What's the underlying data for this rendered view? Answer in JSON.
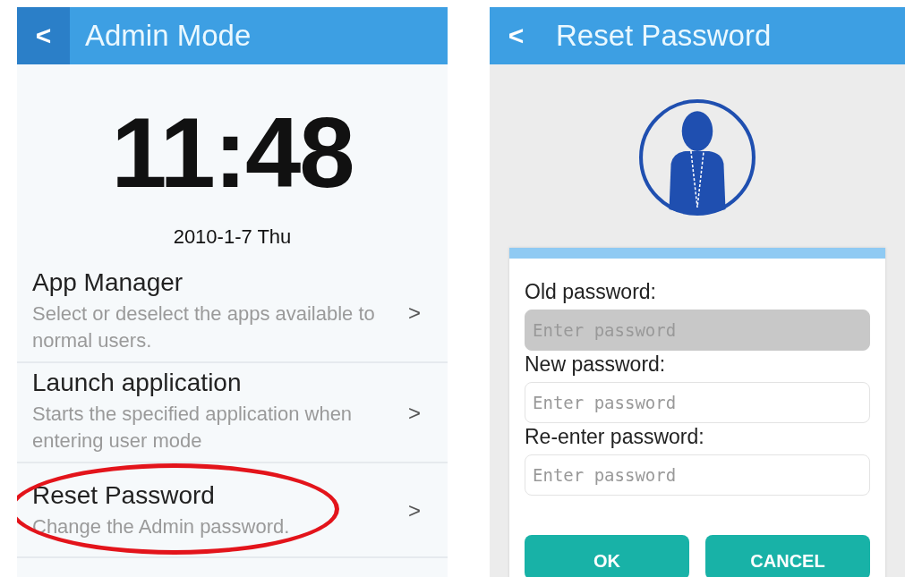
{
  "admin_screen": {
    "title": "Admin Mode",
    "back": "<",
    "clock": "11:48",
    "date": "2010-1-7 Thu",
    "items": [
      {
        "title": "App Manager",
        "subtitle": "Select or deselect the apps available to normal users.",
        "chevron": ">",
        "highlighted": false
      },
      {
        "title": "Launch application",
        "subtitle": "Starts the specified application when entering user mode",
        "chevron": ">",
        "highlighted": false
      },
      {
        "title": "Reset Password",
        "subtitle": "Change the Admin password.",
        "chevron": ">",
        "highlighted": true
      }
    ]
  },
  "reset_screen": {
    "title": "Reset Password",
    "back": "<",
    "fields": [
      {
        "label": "Old password:",
        "placeholder": "Enter password",
        "disabled": true
      },
      {
        "label": "New password:",
        "placeholder": "Enter password",
        "disabled": false
      },
      {
        "label": "Re-enter password:",
        "placeholder": "Enter password",
        "disabled": false
      }
    ],
    "buttons": [
      "OK",
      "CANCEL"
    ]
  }
}
